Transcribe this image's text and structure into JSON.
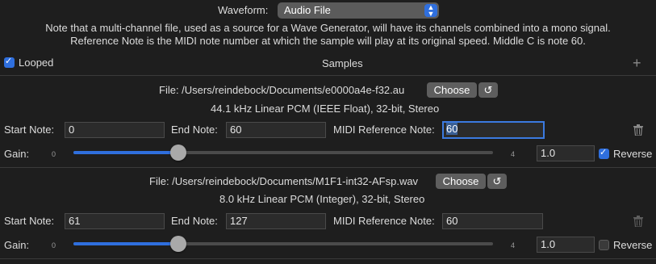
{
  "waveform": {
    "label": "Waveform:",
    "selected": "Audio File"
  },
  "notes": {
    "line1": "Note that a multi-channel file, used as a source for a Wave Generator, will have its channels combined into a mono signal.",
    "line2": "Reference Note is the MIDI note number at which the sample will play at its original speed.  Middle C is note 60."
  },
  "looped": {
    "label": "Looped",
    "checked": true
  },
  "samples_label": "Samples",
  "add_symbol": "+",
  "labels": {
    "start_note": "Start Note:",
    "end_note": "End Note:",
    "midi_reference_note": "MIDI Reference Note:",
    "gain": "Gain:",
    "reverse": "Reverse",
    "choose": "Choose",
    "reset_symbol": "↺",
    "slider_min": "0",
    "slider_max": "4"
  },
  "samples": [
    {
      "file": "File: /Users/reindebock/Documents/e0000a4e-f32.au",
      "format": "44.1 kHz Linear PCM (IEEE Float), 32-bit, Stereo",
      "start_note": "0",
      "end_note": "60",
      "midi_reference_note": "60",
      "gain": "1.0",
      "gain_fraction": 0.25,
      "reverse": true
    },
    {
      "file": "File: /Users/reindebock/Documents/M1F1-int32-AFsp.wav",
      "format": "8.0 kHz Linear PCM (Integer), 32-bit, Stereo",
      "start_note": "61",
      "end_note": "127",
      "midi_reference_note": "60",
      "gain": "1.0",
      "gain_fraction": 0.25,
      "reverse": false
    }
  ],
  "colors": {
    "accent": "#2f6fde",
    "background": "#1e1e1e"
  }
}
